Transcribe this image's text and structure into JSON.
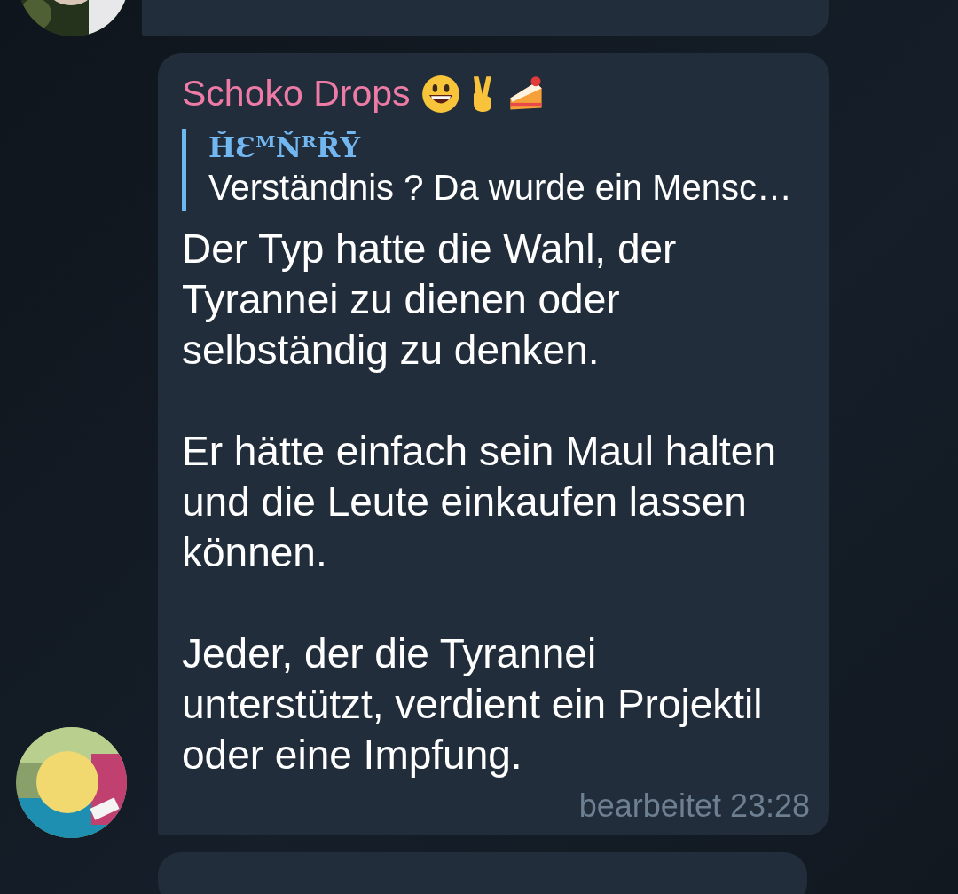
{
  "messages": [
    {
      "kind": "plain"
    },
    {
      "kind": "reply",
      "sender": "Schoko Drops",
      "quote": {
        "author": "H̆ƐᴹŇᴿR̃Ȳ",
        "text": "Verständnis ? Da wurde ein Mensc…"
      },
      "paragraphs": [
        "Der Typ hatte die Wahl, der Tyrannei zu dienen oder selbständig zu denken.",
        "Er hätte einfach sein Maul halten und die Leute einkaufen lassen können.",
        "Jeder, der die Tyrannei unterstützt, verdient ein Projektil oder eine Impfung."
      ],
      "time": "bearbeitet 23:28"
    }
  ]
}
